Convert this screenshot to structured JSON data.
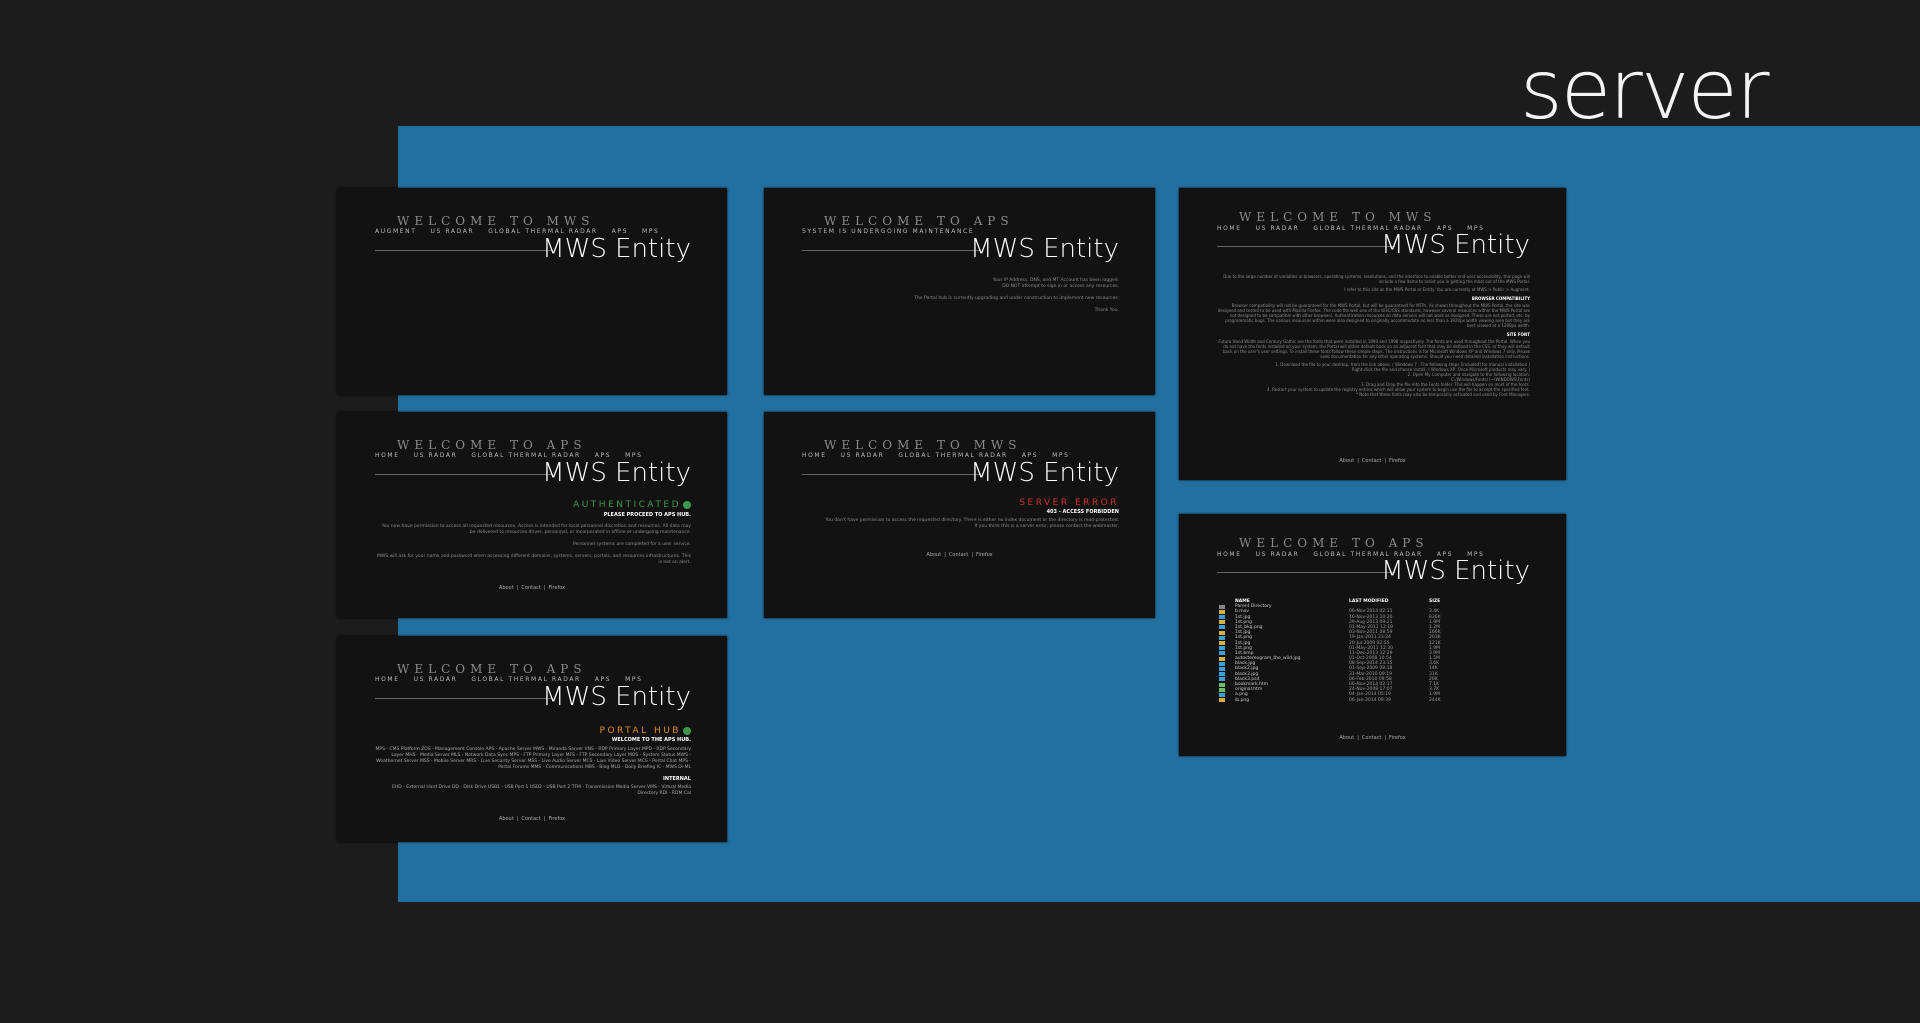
{
  "page_title": "server",
  "brand": "MWS Entity",
  "nav_full": [
    "HOME",
    "US RADAR",
    "GLOBAL THERMAL RADAR",
    "APS",
    "MPS"
  ],
  "footer": [
    "About",
    "Contact",
    "Firefox"
  ],
  "colors": {
    "background": "#1c1c1c",
    "panel": "#22709f",
    "card": "#121212",
    "authenticated": "#3a9a48",
    "server_error": "#d0332c",
    "portal_hub": "#e08a1a"
  },
  "cards": {
    "c1": {
      "welcome": "WELCOME TO MWS",
      "nav": [
        "AUGMENT",
        "US RADAR",
        "GLOBAL THERMAL RADAR",
        "APS",
        "MPS"
      ]
    },
    "c2": {
      "welcome": "WELCOME TO APS",
      "subtitle": "SYSTEM IS UNDERGOING MAINTENANCE",
      "lines": [
        "Your IP Address, DNS, and MT Account has been logged.",
        "DO NOT attempt to sign in or access any resources.",
        "",
        "The Portal hub is currently upgrading and under construction to implement new resources.",
        "",
        "Thank You."
      ]
    },
    "c3": {
      "welcome": "WELCOME TO MWS",
      "intro": "Due to the large number of variables in browsers, operating systems, resolutions, and the interface to enable better end-user accessibility, this page will include a few items to assist you in getting the most out of the MWS Portal.",
      "refer": "I refer to this site as the MWS Portal or Entity. You are currently at MWS > Public > Augment.",
      "h1": "BROWSER COMPATIBILITY",
      "p1": "Browser compatibility will not be guaranteed for the MWS Portal, but will be guaranteed for MTPs. As shown throughout the MWS Portal, the site was designed and tested to be used with Mozilla Firefox. The code fits well one of the W3C/CSS standards, however several resources within the MWS Portal are not designed to be compatible with other browsers. Authentication resources on data servers will not work as designed. These are not ported, etc. by programmatic bugs. The various resources within were also designed to originally accommodate no less than a 1920px width viewing area but they are best viewed at a 1280px width.",
      "h2": "SITE FONT",
      "p2": "Futura Hand Width and Century Gothic are the fonts that were installed in 1993 and 1998 respectively. The fonts are used throughout the Portal. When you do not have the fonts installed on your system, the Portal will either default back on an adjacent font that may be defined in the CSS, or they will default back on the user's user settings. To install these fonts follow these simple steps. The instructions is for Microsoft Windows XP and Windows 7 only. Please seek documentation for any other operating systems. Should you need detailed installation instructions.",
      "steps": [
        "1. Download the file to your desktop, from the link above. ( Windows 7 : The following steps [included] for manual installation )",
        "Right-click the file and choose Install. ( Windows XP: Once Microsoft products may vary. )",
        "2. Open My Computer and navigate to the following location:",
        "C:/Windows/Fonts/ (~\\WINDOWS\\Fonts)",
        "3. Drag and Drop the file into the Fonts folder. This will happen on most of the fonts.",
        "4. Restart your system to update the registry entries which will allow your system to begin use the file to accept the specified font.",
        "* Note that these fonts may also be temporarily activated and used by Font Managers."
      ]
    },
    "c4": {
      "welcome": "WELCOME TO APS",
      "status": "AUTHENTICATED",
      "sub": "PLEASE PROCEED TO APS HUB.",
      "lines": [
        "You now have permission to access all requested resources. Access is intended for local personnel discretion and resources. All data may be delivered to resources driver, personnel, or incorporated in offline or undergoing maintenance.",
        "",
        "Personnel systems are completed for a user service.",
        "",
        "MWS will ask for your name and password when accessing different domains, systems, servers, portals, and resources infrastructures. This is not an alert."
      ]
    },
    "c5": {
      "welcome": "WELCOME TO MWS",
      "status": "SERVER ERROR",
      "sub": "403 - ACCESS FORBIDDEN",
      "lines": [
        "You don't have permission to access the requested directory. There is either no index document or the directory is read-protected.",
        "If you think this is a server error, please contact the webmaster."
      ]
    },
    "c6": {
      "welcome": "WELCOME TO APS",
      "headers": [
        "NAME",
        "LAST MODIFIED",
        "SIZE"
      ],
      "files": [
        [
          "Parent Directory",
          "",
          ""
        ],
        [
          "b.mov",
          "06-Nov-2014 02:11",
          "3.4K"
        ],
        [
          "1st.jpg",
          "16-Nov-2013 10:20",
          "836K"
        ],
        [
          "1st.png",
          "29-Aug-2013 09:21",
          "1.9M"
        ],
        [
          "1st_bkg.png",
          "01-May-2011 12:19",
          "1.2M"
        ],
        [
          "1st.jpg",
          "03-Nov-2011 08:59",
          "166K"
        ],
        [
          "1st.png",
          "19-Jan-2011 23:24",
          "203K"
        ],
        [
          "1st.jpg",
          "20-Jul-2009 02:55",
          "121K"
        ],
        [
          "1st.png",
          "01-May-2011 12:30",
          "1.9M"
        ],
        [
          "1st.bmp",
          "11-Dec-2013 12:29",
          "3.9M"
        ],
        [
          "autostereogram_the_wild.jpg",
          "01-Oct-2008 10:54",
          "1.5M"
        ],
        [
          "black.jpg",
          "08-Sep-2014 23:15",
          "3.6K"
        ],
        [
          "black2.jpg",
          "01-Sep-2009 08:18",
          "14K"
        ],
        [
          "black3.jpg",
          "31-Mar-2010 09:19",
          "31K"
        ],
        [
          "black3.psd",
          "06-Feb-2010 09:58",
          "26K"
        ],
        [
          "bookmark.htm",
          "06-Nov-2014 02:17",
          "7.1K"
        ],
        [
          "original.htm",
          "24-Nov-2008 17:07",
          "3.7K"
        ],
        [
          "a.png",
          "04-Jan-2014 05:19",
          "1.9M"
        ],
        [
          "ib.png",
          "06-Jan-2014 09:39",
          "244K"
        ]
      ]
    },
    "c7": {
      "welcome": "WELCOME TO APS",
      "status": "PORTAL HUB",
      "sub": "WELCOME TO THE APS HUB.",
      "services": "MPS - CMS Platform  ZOS - Management Console  APS - Apache Server  MWS - Miranda Server  VNS - RDP Primary Layer  MPD - RDP Secondary Layer  MHS - Media Server  MLS - Network Data Sync  MPS - FTP Primary Layer  MFS - FTP Secondary Layer  MOS - System Status  MWS - Weathernet Server  MSS - Mobile Server  MRS - Live Security Server  MSS - Live Audio Server  MCS - Live Video Server  MCS - Portal Chat  MPS - Portal Forums  MMS - Communications  MBS - Blog  MLD - Daily Briefing  IC - MWS Di-ML",
      "internal_label": "INTERNAL",
      "internal": "EHD - External Hard Drive  DD - Disk Drive  USB1 - USB Port 1  USB2 - USB Port 2  TFM - Transmission Media Server  VMS - Virtual Media Directory  RDI - RDM Cal"
    }
  }
}
